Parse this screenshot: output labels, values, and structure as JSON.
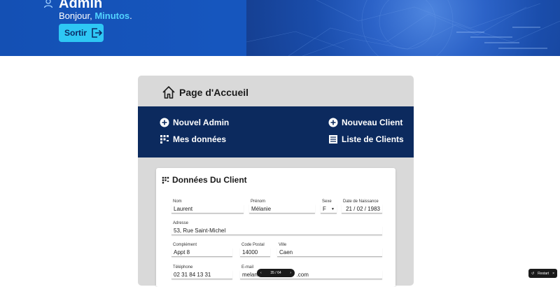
{
  "header": {
    "title": "Admin",
    "greeting_prefix": "Bonjour, ",
    "username": "Minutos",
    "greeting_suffix": ".",
    "logout_label": "Sortir"
  },
  "page": {
    "home_label": "Page d'Accueil"
  },
  "nav": {
    "new_admin": "Nouvel Admin",
    "my_data": "Mes données",
    "new_client": "Nouveau Client",
    "client_list": "Liste de Clients"
  },
  "card": {
    "title": "Données Du Client",
    "fields": {
      "nom": {
        "label": "Nom",
        "value": "Laurent"
      },
      "prenom": {
        "label": "Prénom",
        "value": "Mélanie"
      },
      "sexe": {
        "label": "Sexe",
        "value": "F"
      },
      "naissance": {
        "label": "Date de Naissance",
        "value": "21 / 02 / 1983"
      },
      "adresse": {
        "label": "Adresse",
        "value": "53, Rue Saint-Michel"
      },
      "complement": {
        "label": "Complément",
        "value": "Appt 8"
      },
      "code_postal": {
        "label": "Code Postal",
        "value": "14000"
      },
      "ville": {
        "label": "Ville",
        "value": "Caen"
      },
      "telephone": {
        "label": "Téléphone",
        "value": "02 31 84 13 31"
      },
      "email": {
        "label": "E-mail",
        "value_start": "melani",
        "value_end": ".com"
      }
    }
  },
  "pager": {
    "text": "35 / 64"
  },
  "restart": {
    "label": "Restart"
  },
  "colors": {
    "header_blue": "#1450b4",
    "nav_band": "#0c2a5e",
    "accent_cyan": "#2ec7f4",
    "username": "#52d3ff",
    "panel_gray": "#d9d9d9"
  },
  "icons": [
    "user-icon",
    "logout-icon",
    "home-icon",
    "plus-circle-icon",
    "grid-dots-icon",
    "list-icon",
    "chevron-left-icon",
    "chevron-right-icon",
    "restart-icon",
    "close-icon",
    "caret-down-icon"
  ]
}
